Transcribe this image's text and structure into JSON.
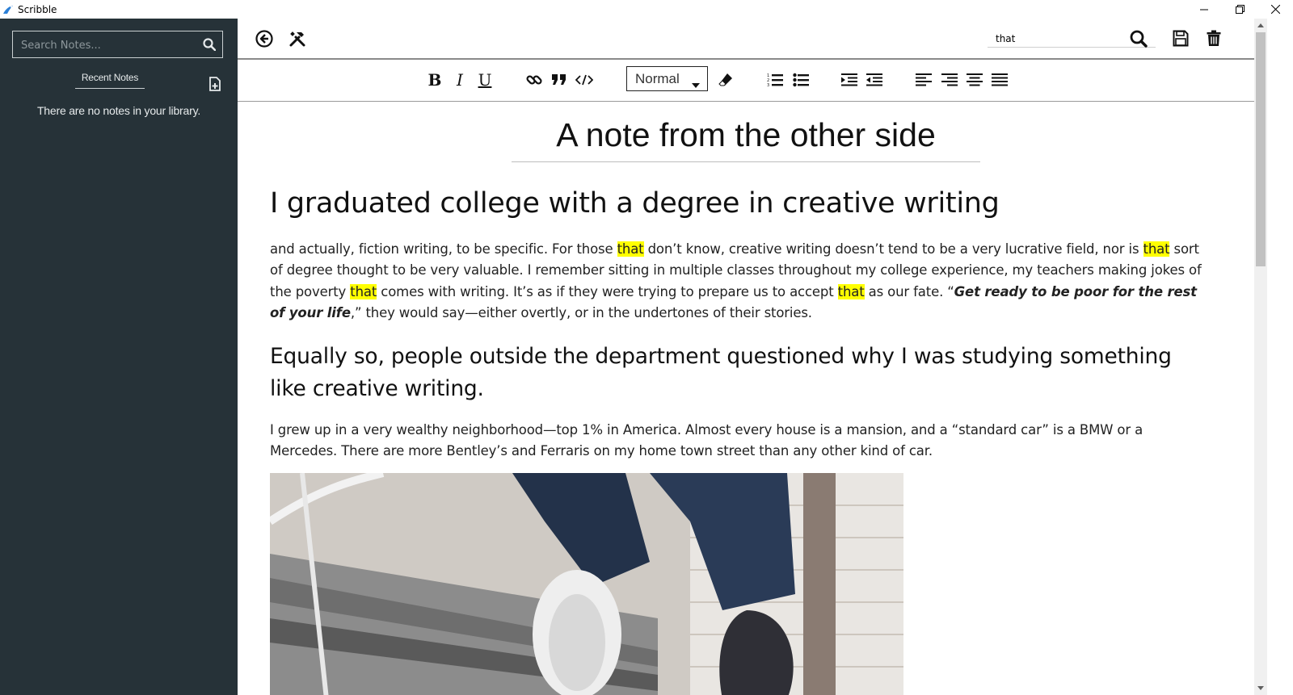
{
  "window": {
    "title": "Scribble"
  },
  "sidebar": {
    "search_placeholder": "Search Notes...",
    "recent_label": "Recent Notes",
    "empty_message": "There are no notes in your library."
  },
  "topbar": {
    "find_value": "that"
  },
  "toolbar": {
    "bold": "B",
    "italic": "I",
    "underline": "U",
    "style_value": "Normal"
  },
  "document": {
    "title": "A note from the other side",
    "heading1": "I graduated college with a degree in creative writing",
    "p1": [
      {
        "t": "and actually, fiction writing, to be specific. For those "
      },
      {
        "t": "that",
        "hl": true
      },
      {
        "t": " don’t know, creative writing doesn’t tend to be a very lucrative field, nor is "
      },
      {
        "t": "that",
        "hl": true
      },
      {
        "t": " sort of degree thought to be very valuable. I remember sitting in multiple classes throughout my college experience, my teachers making jokes of the poverty "
      },
      {
        "t": "that",
        "hl": true
      },
      {
        "t": " comes with writing. It’s as if they were trying to prepare us to accept "
      },
      {
        "t": "that",
        "hl": true
      },
      {
        "t": " as our fate. “"
      },
      {
        "t": "Get ready to be poor for the rest of your life",
        "bi": true
      },
      {
        "t": ",” they would say—either overtly, or in the undertones of their stories."
      }
    ],
    "heading2": "Equally so, people outside the department questioned why I was studying something like creative writing.",
    "p2": "I grew up in a very wealthy neighborhood—top 1% in America. Almost every house is a mansion, and a “standard car” is a BMW or a Mercedes. There are more Bentley’s and Ferraris on my home town street than any other kind of car."
  },
  "colors": {
    "sidebar_bg": "#263238",
    "highlight": "#ffff00"
  }
}
